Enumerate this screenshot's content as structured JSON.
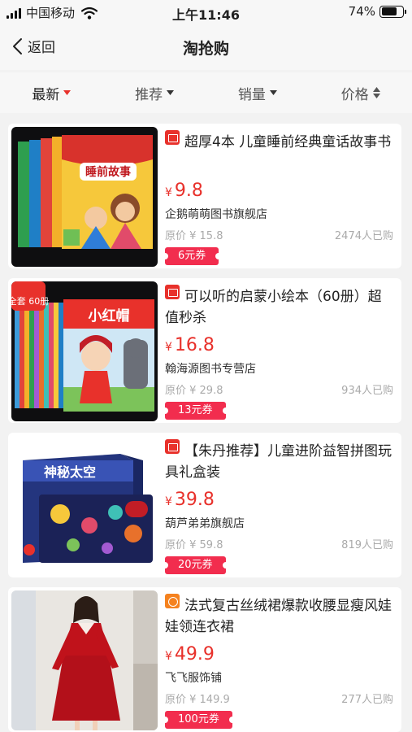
{
  "status": {
    "carrier": "中国移动",
    "time": "上午11:46",
    "battery": "74%",
    "battery_level": 0.74
  },
  "nav": {
    "back_label": "返回",
    "title": "淘抢购"
  },
  "filters": [
    {
      "label": "最新",
      "indicator": "arrow-down",
      "active": true
    },
    {
      "label": "推荐",
      "indicator": "arrow-down",
      "active": false
    },
    {
      "label": "销量",
      "indicator": "arrow-down",
      "active": false
    },
    {
      "label": "价格",
      "indicator": "sort-updown",
      "active": false
    }
  ],
  "colors": {
    "accent": "#e8312b",
    "coupon": "#f22d4e",
    "tmall_badge": "#e8312b",
    "taobao_badge": "#f5821f"
  },
  "products": [
    {
      "badge": "tmall",
      "image": "bedtime-story-books",
      "image_text": "睡前故事",
      "image_tag": "",
      "title": "超厚4本 儿童睡前经典童话故事书",
      "currency": "¥",
      "price": "9.8",
      "shop": "企鹅萌萌图书旗舰店",
      "original": "原价 ¥ 15.8",
      "sold": "2474人已购",
      "coupon": "6元券"
    },
    {
      "badge": "tmall",
      "image": "little-red-riding-hood-books",
      "image_text": "小红帽",
      "image_tag": "全套 60册",
      "title": "可以听的启蒙小绘本（60册）超值秒杀",
      "currency": "¥",
      "price": "16.8",
      "shop": "翰海源图书专营店",
      "original": "原价 ¥ 29.8",
      "sold": "934人已购",
      "coupon": "13元券"
    },
    {
      "badge": "tmall",
      "image": "space-puzzle-box",
      "image_text": "神秘太空",
      "image_tag": "",
      "title": "【朱丹推荐】儿童进阶益智拼图玩具礼盒装",
      "currency": "¥",
      "price": "39.8",
      "shop": "葫芦弟弟旗舰店",
      "original": "原价 ¥ 59.8",
      "sold": "819人已购",
      "coupon": "20元券"
    },
    {
      "badge": "taobao",
      "image": "red-velvet-dress",
      "image_text": "",
      "image_tag": "",
      "title": "法式复古丝绒裙爆款收腰显瘦风娃娃领连衣裙",
      "currency": "¥",
      "price": "49.9",
      "shop": "飞飞服饰铺",
      "original": "原价 ¥ 149.9",
      "sold": "277人已购",
      "coupon": "100元券"
    }
  ]
}
